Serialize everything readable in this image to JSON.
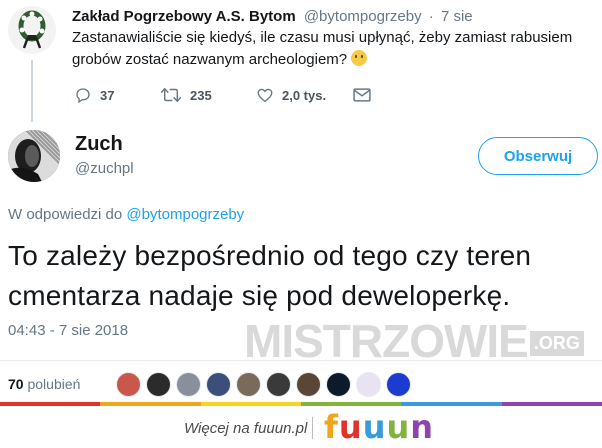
{
  "parent_tweet": {
    "name": "Zakład Pogrzebowy A.S. Bytom",
    "handle": "@bytompogrzeby",
    "separator": "·",
    "time": "7 sie",
    "text": "Zastanawialiście się kiedyś, ile czasu musi upłynąć, żeby zamiast rabusiem grobów zostać nazwanym archeologiem?",
    "emoji": "thinking-face",
    "actions": {
      "replies": "37",
      "retweets": "235",
      "likes": "2,0 tys."
    }
  },
  "reply_tweet": {
    "name": "Zuch",
    "handle": "@zuchpl",
    "follow_label": "Obserwuj",
    "reply_prefix": "W odpowiedzi do",
    "reply_to": "@bytompogrzeby",
    "text": "To zależy bezpośrednio od tego czy teren cmentarza nadaje się pod deweloperkę.",
    "timestamp": "04:43 - 7 sie 2018",
    "likes_count": "70",
    "likes_label": "polubień",
    "likers": [
      {
        "icon": "avatar-woman-redhead",
        "color": "#c9574a"
      },
      {
        "icon": "avatar-gasmask",
        "color": "#2b2b2b"
      },
      {
        "icon": "avatar-face-gray",
        "color": "#8a8f9c"
      },
      {
        "icon": "avatar-blue-dark",
        "color": "#3c4f7a"
      },
      {
        "icon": "avatar-man-glasses",
        "color": "#7a6a58"
      },
      {
        "icon": "avatar-dark-logo",
        "color": "#3a3a3a"
      },
      {
        "icon": "avatar-man-suit",
        "color": "#5a4636"
      },
      {
        "icon": "avatar-eclipse",
        "color": "#0c1a2b"
      },
      {
        "icon": "avatar-psycho-logger",
        "color": "#e8e2f2"
      },
      {
        "icon": "avatar-blue-neon",
        "color": "#1b3ccf"
      }
    ]
  },
  "watermark": {
    "text": "MISTRZOWIE",
    "suffix": ".ORG"
  },
  "footer": {
    "more_text": "Więcej na fuuun.pl",
    "brand_letters": [
      {
        "char": "f",
        "color": "#f0a51e"
      },
      {
        "char": "u",
        "color": "#e2332a"
      },
      {
        "char": "u",
        "color": "#3a9bd9"
      },
      {
        "char": "u",
        "color": "#7fb53d"
      },
      {
        "char": "n",
        "color": "#8e44ad"
      }
    ],
    "stripe_colors": [
      "#e2332a",
      "#f0a51e",
      "#f5d51e",
      "#7fb53d",
      "#3a9bd9",
      "#8e44ad"
    ]
  },
  "colors": {
    "accent": "#1da1f2",
    "text": "#14171a",
    "muted": "#657786"
  }
}
